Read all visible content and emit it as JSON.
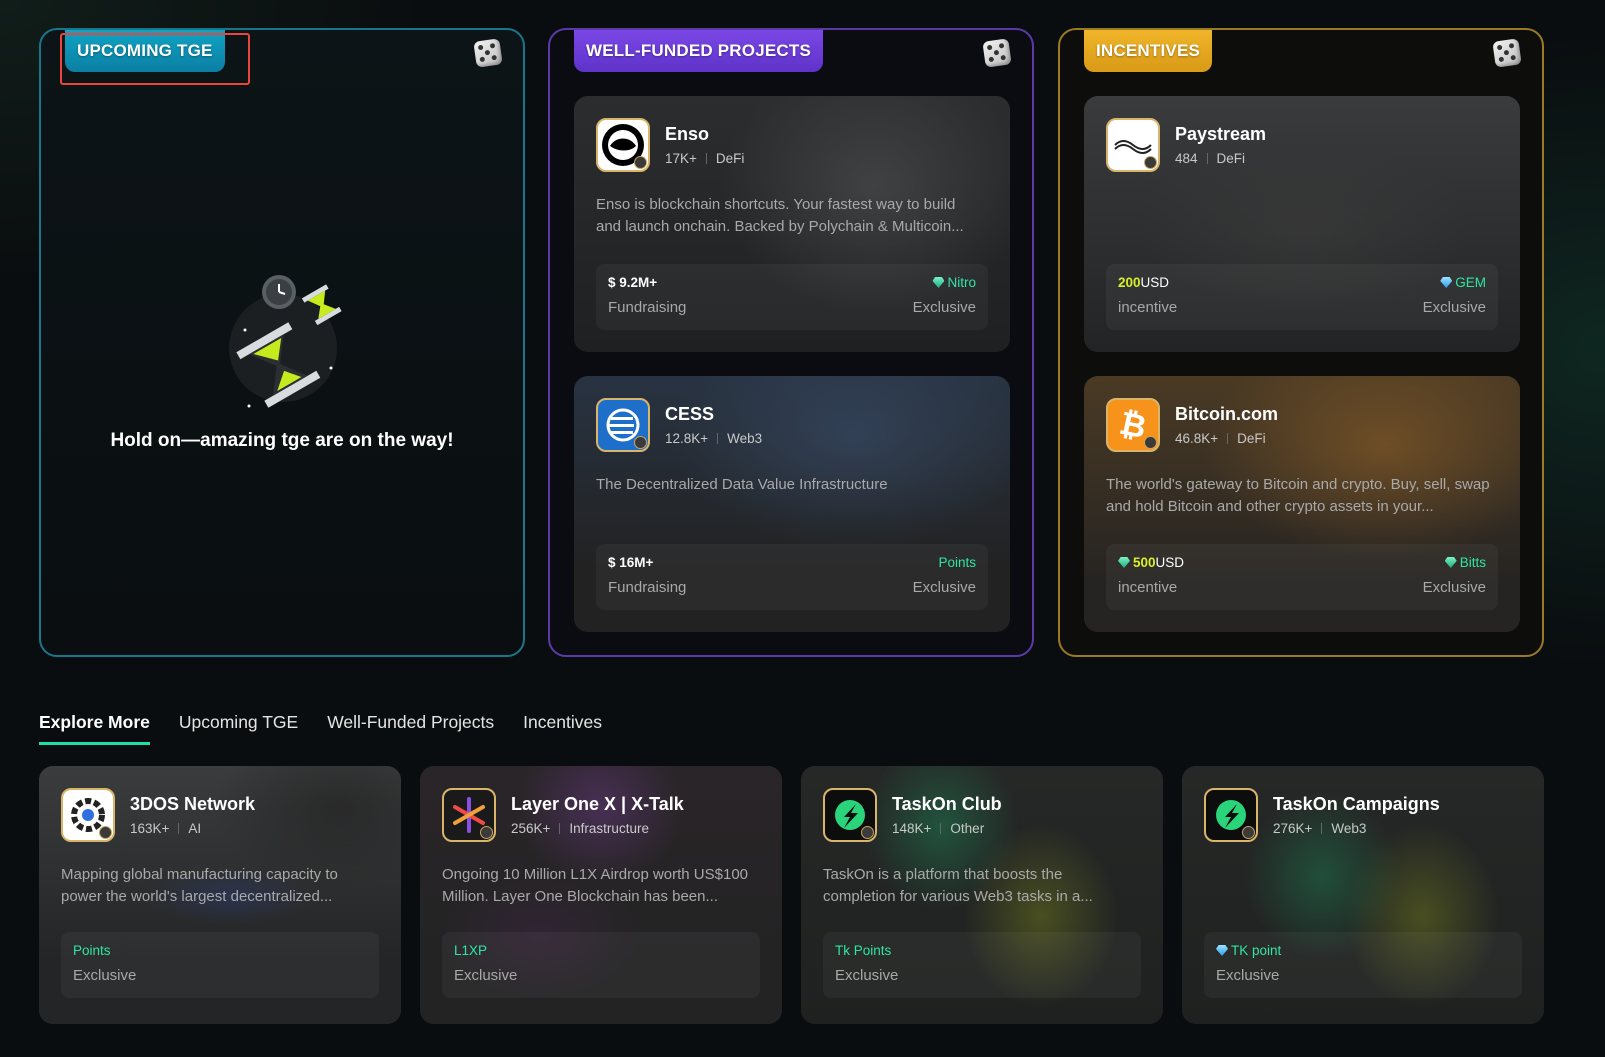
{
  "panels": {
    "tge": {
      "tag": "UPCOMING TGE",
      "empty_message": "Hold on—amazing tge are on the way!"
    },
    "funded": {
      "tag": "WELL-FUNDED PROJECTS",
      "cards": [
        {
          "name": "Enso",
          "followers": "17K+",
          "category": "DeFi",
          "description": "Enso is blockchain shortcuts. Your fastest way to build and launch onchain. Backed by Polychain & Multicoin...",
          "amount": "$ 9.2M+",
          "amount_label": "Fundraising",
          "reward": "Nitro",
          "reward_icon": "gem-icon",
          "reward_label": "Exclusive"
        },
        {
          "name": "CESS",
          "followers": "12.8K+",
          "category": "Web3",
          "description": "The Decentralized Data Value Infrastructure",
          "amount": "$ 16M+",
          "amount_label": "Fundraising",
          "reward": "Points",
          "reward_label": "Exclusive"
        }
      ]
    },
    "incentives": {
      "tag": "INCENTIVES",
      "cards": [
        {
          "name": "Paystream",
          "followers": "484",
          "category": "DeFi",
          "description": "",
          "amount_value": "200",
          "amount_currency": "USD",
          "amount_label": "incentive",
          "reward": "GEM",
          "reward_icon": "diamond-icon",
          "reward_label": "Exclusive"
        },
        {
          "name": "Bitcoin.com",
          "followers": "46.8K+",
          "category": "DeFi",
          "description": "The world's gateway to Bitcoin and crypto. Buy, sell, swap and hold Bitcoin and other crypto assets in your...",
          "amount_value": "500",
          "amount_currency": "USD",
          "amount_label": "incentive",
          "reward": "Bitts",
          "reward_icon": "gem-icon",
          "reward_label": "Exclusive"
        }
      ]
    }
  },
  "tabs": [
    {
      "label": "Explore More",
      "active": true
    },
    {
      "label": "Upcoming TGE",
      "active": false
    },
    {
      "label": "Well-Funded Projects",
      "active": false
    },
    {
      "label": "Incentives",
      "active": false
    }
  ],
  "explore": [
    {
      "name": "3DOS Network",
      "followers": "163K+",
      "category": "AI",
      "description": "Mapping global manufacturing capacity to power the world's largest decentralized...",
      "reward": "Points",
      "reward_label": "Exclusive"
    },
    {
      "name": "Layer One X | X-Talk",
      "followers": "256K+",
      "category": "Infrastructure",
      "description": "Ongoing 10 Million L1X Airdrop worth US$100 Million. Layer One Blockchain has been...",
      "reward": "L1XP",
      "reward_label": "Exclusive"
    },
    {
      "name": "TaskOn Club",
      "followers": "148K+",
      "category": "Other",
      "description": "TaskOn is a platform that boosts the completion for various Web3 tasks in a...",
      "reward": "Tk Points",
      "reward_label": "Exclusive"
    },
    {
      "name": "TaskOn Campaigns",
      "followers": "276K+",
      "category": "Web3",
      "description": "",
      "reward": "TK point",
      "reward_icon": "diamond-icon",
      "reward_label": "Exclusive"
    }
  ],
  "colors": {
    "tge_border": "#17778a",
    "funded_border": "#5b3aa8",
    "incentives_border": "#9a7a25",
    "accent_green": "#2ee6a2",
    "highlight_red": "#e8463f"
  }
}
